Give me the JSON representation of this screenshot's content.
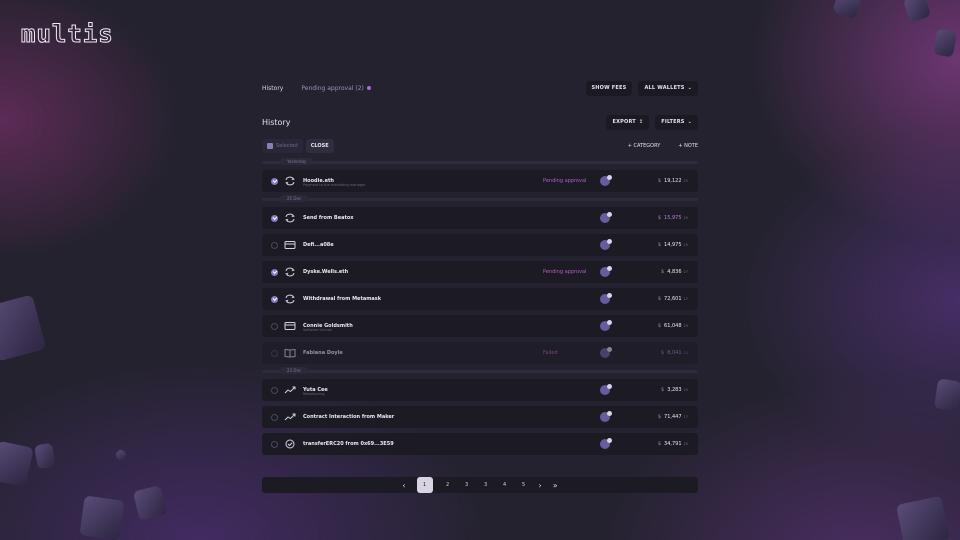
{
  "logo": "multis",
  "topbar": {
    "title": "History",
    "pending": "Pending approval (2)",
    "show_fees": "SHOW FEES",
    "all_wallets": "ALL WALLETS"
  },
  "section": {
    "title": "History",
    "export": "EXPORT",
    "filters": "FILTERS"
  },
  "actions": {
    "selected": "Selected",
    "close": "CLOSE",
    "category": "+ CATEGORY",
    "note": "+ NOTE"
  },
  "groups": [
    {
      "day": "Yesterday"
    },
    {
      "day": "25 Dec"
    },
    {
      "day": "23 Dec"
    }
  ],
  "transactions": [
    {
      "main": "Hoodie.eth",
      "sub": "Payment to the marketing manager",
      "status": "Pending approval",
      "currency": "$",
      "amount": "19,122",
      "unit": "25",
      "checked": true,
      "icon": "swap-icon",
      "pending": false
    },
    {
      "main": "Send from Beatox",
      "sub": "",
      "status": "",
      "currency": "$",
      "amount": "15,975",
      "unit": "25",
      "checked": true,
      "icon": "swap-icon",
      "pending": true
    },
    {
      "main": "Defi...a08e",
      "sub": "",
      "status": "",
      "currency": "$",
      "amount": "14,975",
      "unit": "25",
      "checked": false,
      "icon": "card-icon",
      "pending": false
    },
    {
      "main": "Dyske.Wells.eth",
      "sub": "",
      "status": "Pending approval",
      "currency": "$",
      "amount": "4,836",
      "unit": "27",
      "checked": true,
      "icon": "swap-icon",
      "pending": false
    },
    {
      "main": "Withdrawal from Metamask",
      "sub": "",
      "status": "",
      "currency": "$",
      "amount": "72,601",
      "unit": "17",
      "checked": true,
      "icon": "swap-icon",
      "pending": false
    },
    {
      "main": "Connie Goldsmith",
      "sub": "Software license",
      "status": "",
      "currency": "$",
      "amount": "61,048",
      "unit": "25",
      "checked": false,
      "icon": "card-icon",
      "pending": false
    },
    {
      "main": "Fabiana Doyle",
      "sub": "",
      "status": "Failed",
      "currency": "$",
      "amount": "8,041",
      "unit": "25",
      "checked": false,
      "icon": "book-icon",
      "pending": true,
      "dim": true
    },
    {
      "main": "Yuta Cee",
      "sub": "Rebalancing",
      "status": "",
      "currency": "$",
      "amount": "3,283",
      "unit": "25",
      "checked": false,
      "icon": "trend-icon",
      "pending": false
    },
    {
      "main": "Contract Interaction from Maker",
      "sub": "",
      "status": "",
      "currency": "$",
      "amount": "71,447",
      "unit": "17",
      "checked": false,
      "icon": "trend-icon",
      "pending": false
    },
    {
      "main": "transferERC20 from 0x69...3E59",
      "sub": "",
      "status": "",
      "currency": "$",
      "amount": "34,791",
      "unit": "25",
      "checked": false,
      "icon": "check-circle-icon",
      "pending": false
    }
  ],
  "pagination": {
    "pages": [
      "1",
      "2",
      "3",
      "3",
      "4",
      "5"
    ],
    "prev": "‹",
    "next": "›",
    "last": "»"
  }
}
